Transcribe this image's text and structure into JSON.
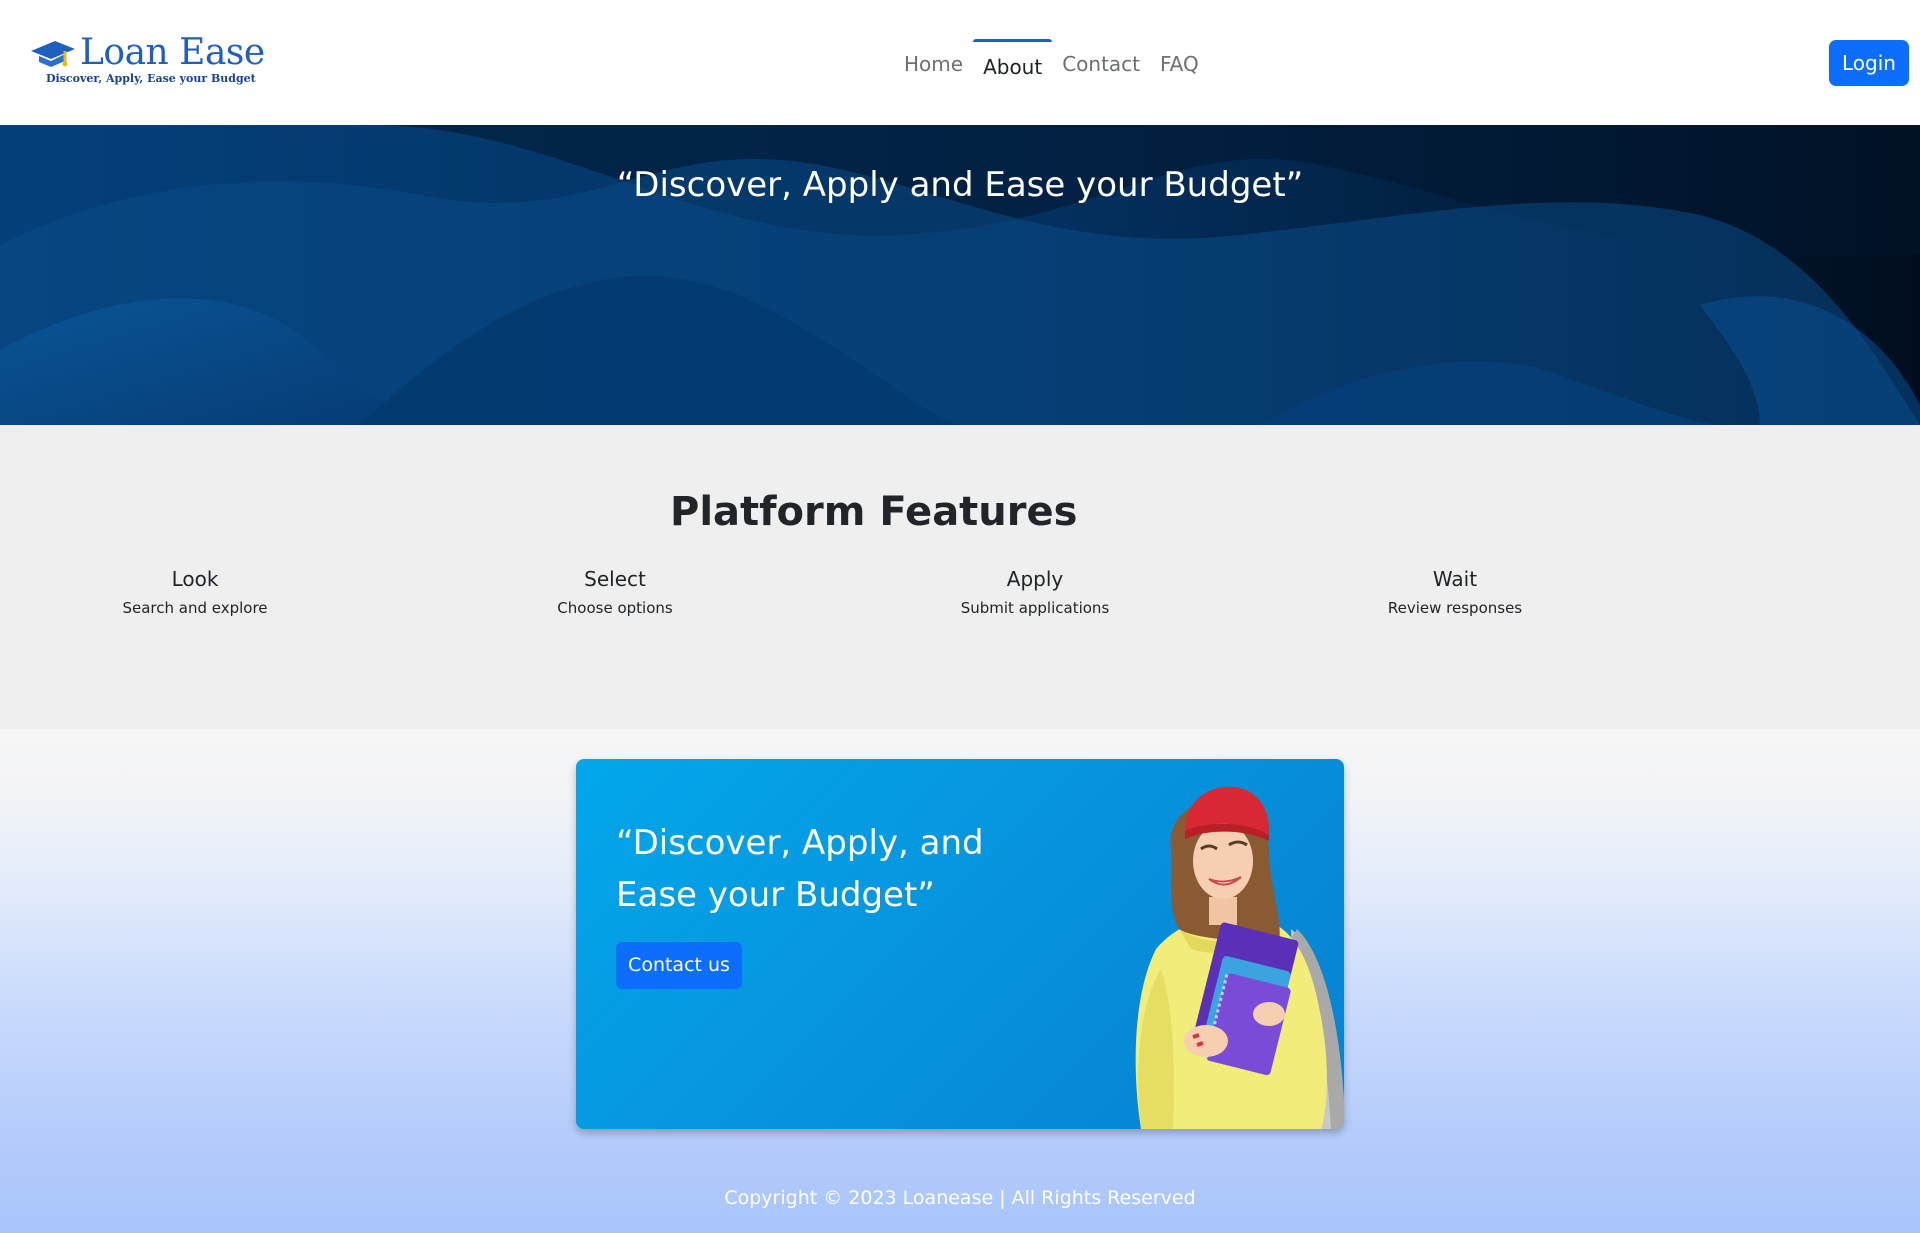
{
  "brand": {
    "name": "Loan Ease",
    "tagline": "Discover, Apply, Ease your Budget"
  },
  "nav": {
    "items": [
      {
        "label": "Home",
        "active": false
      },
      {
        "label": "About",
        "active": true
      },
      {
        "label": "Contact",
        "active": false
      },
      {
        "label": "FAQ",
        "active": false
      }
    ],
    "login_label": "Login"
  },
  "hero": {
    "quote": "“Discover, Apply and Ease your Budget”"
  },
  "features": {
    "title": "Platform Features",
    "items": [
      {
        "name": "Look",
        "description": "Search and explore"
      },
      {
        "name": "Select",
        "description": "Choose options"
      },
      {
        "name": "Apply",
        "description": "Submit applications"
      },
      {
        "name": "Wait",
        "description": "Review responses"
      }
    ]
  },
  "promo": {
    "quote": "“Discover, Apply, and Ease your Budget”",
    "button_label": "Contact us"
  },
  "footer": {
    "copyright": "Copyright © 2023 Loanease | All Rights Reserved"
  },
  "colors": {
    "primary": "#0d6efd",
    "brand": "#1f5fbf",
    "hero_dark": "#02152f",
    "hero_wave": "#0a4f8f",
    "features_bg": "#efefef",
    "promo_bg": "#0793dc"
  }
}
